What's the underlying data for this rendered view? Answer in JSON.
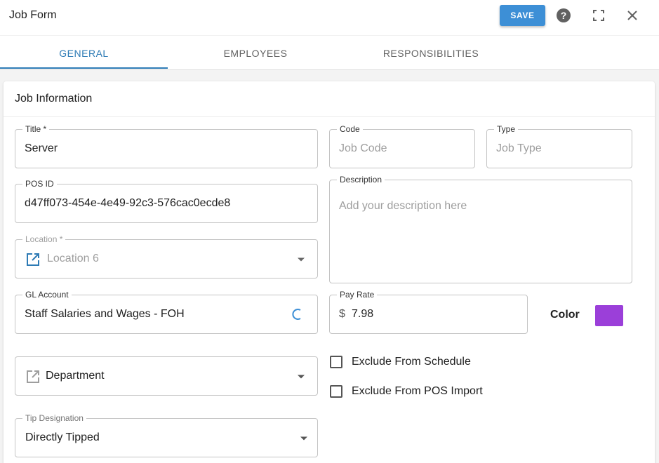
{
  "header": {
    "title": "Job Form",
    "save_label": "SAVE",
    "icons": [
      "help-icon",
      "fullscreen-icon",
      "close-icon"
    ]
  },
  "tabs": [
    {
      "label": "GENERAL",
      "active": true
    },
    {
      "label": "EMPLOYEES",
      "active": false
    },
    {
      "label": "RESPONSIBILITIES",
      "active": false
    }
  ],
  "card": {
    "title": "Job Information"
  },
  "fields": {
    "title": {
      "label": "Title *",
      "value": "Server"
    },
    "code": {
      "label": "Code",
      "placeholder": "Job Code"
    },
    "type": {
      "label": "Type",
      "placeholder": "Job Type"
    },
    "pos_id": {
      "label": "POS ID",
      "value": "d47ff073-454e-4e49-92c3-576cac0ecde8"
    },
    "description": {
      "label": "Description",
      "placeholder": "Add your description here"
    },
    "location": {
      "label": "Location *",
      "value": "Location 6"
    },
    "gl_account": {
      "label": "GL Account",
      "value": "Staff Salaries and Wages - FOH"
    },
    "pay_rate": {
      "label": "Pay Rate",
      "currency": "$",
      "value": "7.98"
    },
    "department": {
      "value": "Department"
    },
    "tip_designation": {
      "label": "Tip Designation",
      "value": "Directly Tipped"
    }
  },
  "checkboxes": {
    "exclude_schedule": {
      "label": "Exclude From Schedule",
      "checked": false
    },
    "exclude_pos_import": {
      "label": "Exclude From POS Import",
      "checked": false
    }
  },
  "color": {
    "label": "Color",
    "value": "#9b3fd9"
  },
  "theme": {
    "accent": "#2e7bb5",
    "save_button": "#3d8fd6"
  }
}
